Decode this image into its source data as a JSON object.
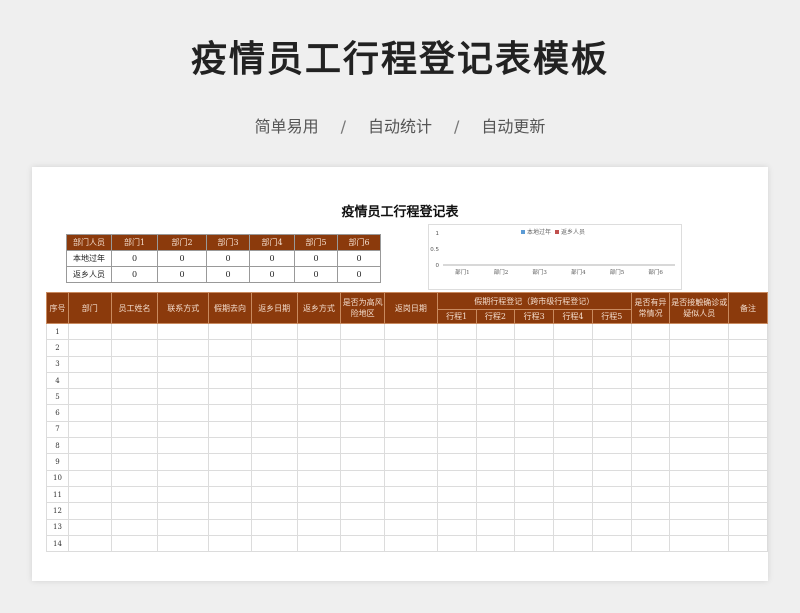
{
  "page": {
    "title": "疫情员工行程登记表模板",
    "tags": [
      "简单易用",
      "自动统计",
      "自动更新"
    ],
    "separator": "/"
  },
  "sheet": {
    "title": "疫情员工行程登记表",
    "summary": {
      "corner": "部门人员",
      "departments": [
        "部门1",
        "部门2",
        "部门3",
        "部门4",
        "部门5",
        "部门6"
      ],
      "rows": [
        {
          "label": "本地过年",
          "values": [
            "0",
            "0",
            "0",
            "0",
            "0",
            "0"
          ]
        },
        {
          "label": "返乡人员",
          "values": [
            "0",
            "0",
            "0",
            "0",
            "0",
            "0"
          ]
        }
      ]
    },
    "main_table": {
      "headers": {
        "seq": "序号",
        "dept": "部门",
        "name": "员工姓名",
        "contact": "联系方式",
        "destination": "假期去向",
        "return_date": "返乡日期",
        "return_mode": "返乡方式",
        "high_risk": "是否为高风险地区",
        "back_date": "返岗日期",
        "itinerary_group": "假期行程登记（跨市级行程登记）",
        "itineraries": [
          "行程1",
          "行程2",
          "行程3",
          "行程4",
          "行程5"
        ],
        "abnormal": "是否有异常情况",
        "contact_confirmed": "是否接触确诊或疑似人员",
        "remark": "备注"
      },
      "row_numbers": [
        "1",
        "2",
        "3",
        "4",
        "5",
        "6",
        "7",
        "8",
        "9",
        "10",
        "11",
        "12",
        "13",
        "14"
      ]
    }
  },
  "chart_data": {
    "type": "bar",
    "categories": [
      "部门1",
      "部门2",
      "部门3",
      "部门4",
      "部门5",
      "部门6"
    ],
    "series": [
      {
        "name": "本地过年",
        "values": [
          0,
          0,
          0,
          0,
          0,
          0
        ],
        "color": "#5b9bd5"
      },
      {
        "name": "返乡人员",
        "values": [
          0,
          0,
          0,
          0,
          0,
          0
        ],
        "color": "#c0504d"
      }
    ],
    "yticks": [
      "0",
      "0.5",
      "1"
    ],
    "ylim": [
      0,
      1
    ],
    "legend": "top",
    "grid": false
  },
  "colors": {
    "header_bg": "#8b3a0c",
    "header_text": "#f3dccc"
  }
}
